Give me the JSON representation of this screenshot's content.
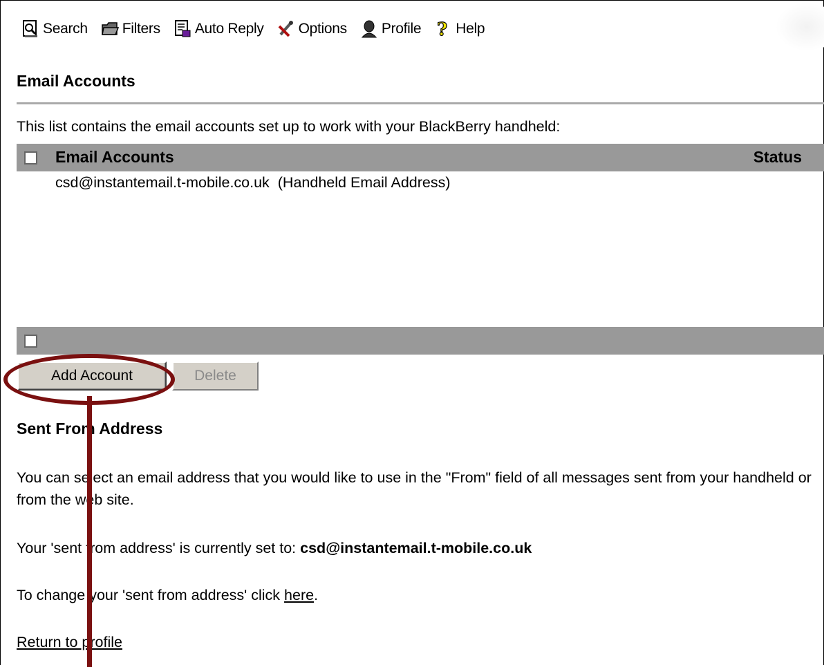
{
  "toolbar": {
    "items": [
      {
        "label": "Search",
        "icon": "search-page-icon"
      },
      {
        "label": "Filters",
        "icon": "folder-icon"
      },
      {
        "label": "Auto Reply",
        "icon": "auto-reply-doc-icon"
      },
      {
        "label": "Options",
        "icon": "options-tools-icon"
      },
      {
        "label": "Profile",
        "icon": "person-bust-icon"
      },
      {
        "label": "Help",
        "icon": "question-mark-icon"
      }
    ]
  },
  "email_accounts": {
    "heading": "Email Accounts",
    "intro": "This list contains the email accounts set up to work with your BlackBerry handheld:",
    "columns": {
      "accounts": "Email Accounts",
      "status": "Status"
    },
    "rows": [
      {
        "address": "csd@instantemail.t-mobile.co.uk",
        "note": "(Handheld Email Address)",
        "status": ""
      }
    ]
  },
  "actions": {
    "add_label": "Add Account",
    "delete_label": "Delete"
  },
  "sent_from": {
    "heading": "Sent From Address",
    "description": "You can select an email address that you would like to use in the \"From\" field of all messages sent from your handheld or from the web site.",
    "current_prefix": "Your 'sent from address' is currently set to:",
    "current_value": "csd@instantemail.t-mobile.co.uk",
    "change_prefix": "To change your 'sent from address' click",
    "change_link": "here",
    "change_suffix": "."
  },
  "return_link": "Return to profile",
  "annotation": {
    "color": "#7a1010"
  }
}
